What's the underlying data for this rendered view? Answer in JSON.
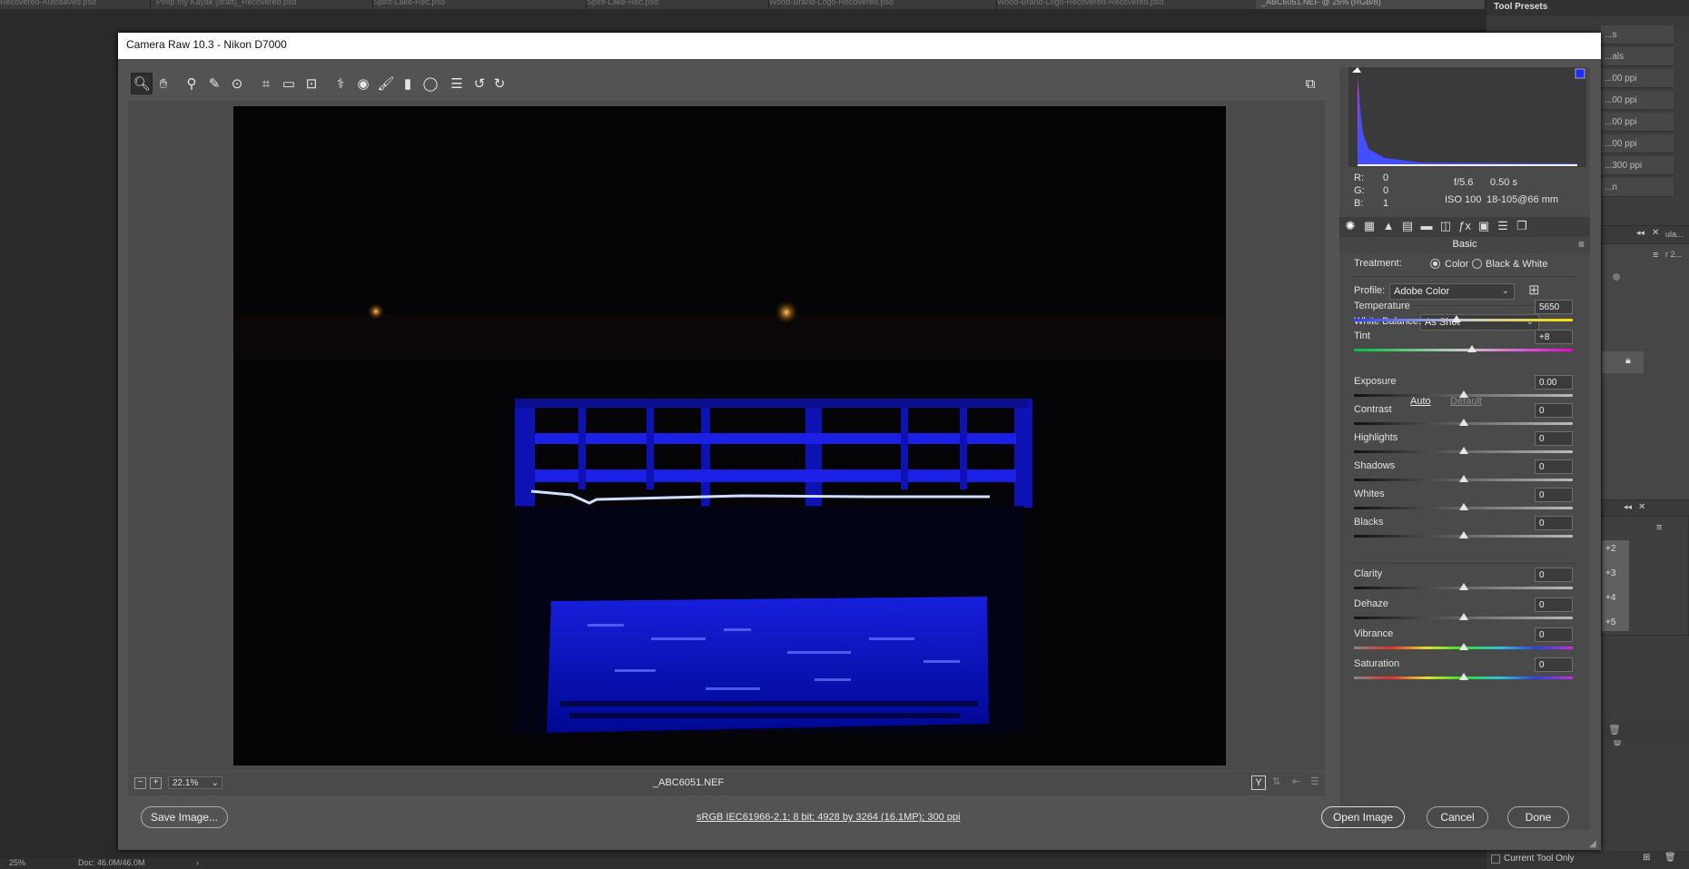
{
  "ps_tabs": [
    "Recovered-Autosaved.psd",
    "Pimp my Kayak (draft)_Recovered.psd",
    "Spirit-Lake-Rec.psd",
    "Spirit-Lake-Rec.psd",
    "Wood-Brand-Logo-Recovered.psd",
    "Wood-Brand-Logo-Recovered-Recovered.psd",
    "_ABC6051.NEF @ 25% (RGB/8)"
  ],
  "tool_presets": {
    "title": "Tool Presets",
    "rows": [
      "...s",
      "...als",
      "...00 ppi",
      "...00 ppi",
      "...00 ppi",
      "...00 ppi",
      "...300 ppi",
      "...n"
    ],
    "layer_items": [
      "+2",
      "+3",
      "+4",
      "+5"
    ],
    "panel_label_a": "ula...",
    "panel_label_b": "r 2...",
    "current_tool_only": "Current Tool Only"
  },
  "ps_status": {
    "zoom": "25%",
    "doc": "Doc: 46.0M/46.0M",
    "arrow": "›"
  },
  "dialog": {
    "title": "Camera Raw 10.3  -  Nikon D7000",
    "filename": "_ABC6051.NEF",
    "zoom_value": "22.1%",
    "zoom_minus": "−",
    "zoom_plus": "+",
    "workflow_link": "sRGB IEC61966-2.1; 8 bit; 4928 by 3264 (16.1MP); 300 ppi",
    "buttons": {
      "save": "Save Image...",
      "open": "Open Image",
      "cancel": "Cancel",
      "done": "Done"
    },
    "toolbar_icons": [
      "zoom-tool-icon",
      "hand-tool-icon",
      "white-balance-tool-icon",
      "color-sampler-icon",
      "targeted-adjustment-icon",
      "crop-tool-icon",
      "straighten-tool-icon",
      "transform-tool-icon",
      "spot-removal-icon",
      "red-eye-icon",
      "adjustment-brush-icon",
      "graduated-filter-icon",
      "radial-filter-icon",
      "preferences-icon",
      "rotate-left-icon",
      "rotate-right-icon"
    ]
  },
  "info": {
    "r_label": "R:",
    "r": "0",
    "g_label": "G:",
    "g": "0",
    "b_label": "B:",
    "b": "1",
    "aperture": "f/5.6",
    "shutter": "0.50 s",
    "iso": "ISO 100",
    "lens": "18-105@66 mm"
  },
  "basic": {
    "panel_title": "Basic",
    "treatment_label": "Treatment:",
    "treatment_color": "Color",
    "treatment_bw": "Black & White",
    "profile_label": "Profile:",
    "profile_value": "Adobe Color",
    "wb_label": "White Balance:",
    "wb_value": "As Shot",
    "auto": "Auto",
    "default": "Default",
    "sliders": [
      {
        "name": "Temperature",
        "value": "5650",
        "pos": 0.47
      },
      {
        "name": "Tint",
        "value": "+8",
        "pos": 0.54
      },
      {
        "name": "Exposure",
        "value": "0.00",
        "pos": 0.5
      },
      {
        "name": "Contrast",
        "value": "0",
        "pos": 0.5
      },
      {
        "name": "Highlights",
        "value": "0",
        "pos": 0.5
      },
      {
        "name": "Shadows",
        "value": "0",
        "pos": 0.5
      },
      {
        "name": "Whites",
        "value": "0",
        "pos": 0.5
      },
      {
        "name": "Blacks",
        "value": "0",
        "pos": 0.5
      },
      {
        "name": "Clarity",
        "value": "0",
        "pos": 0.5
      },
      {
        "name": "Dehaze",
        "value": "0",
        "pos": 0.5
      },
      {
        "name": "Vibrance",
        "value": "0",
        "pos": 0.5
      },
      {
        "name": "Saturation",
        "value": "0",
        "pos": 0.5
      }
    ]
  }
}
